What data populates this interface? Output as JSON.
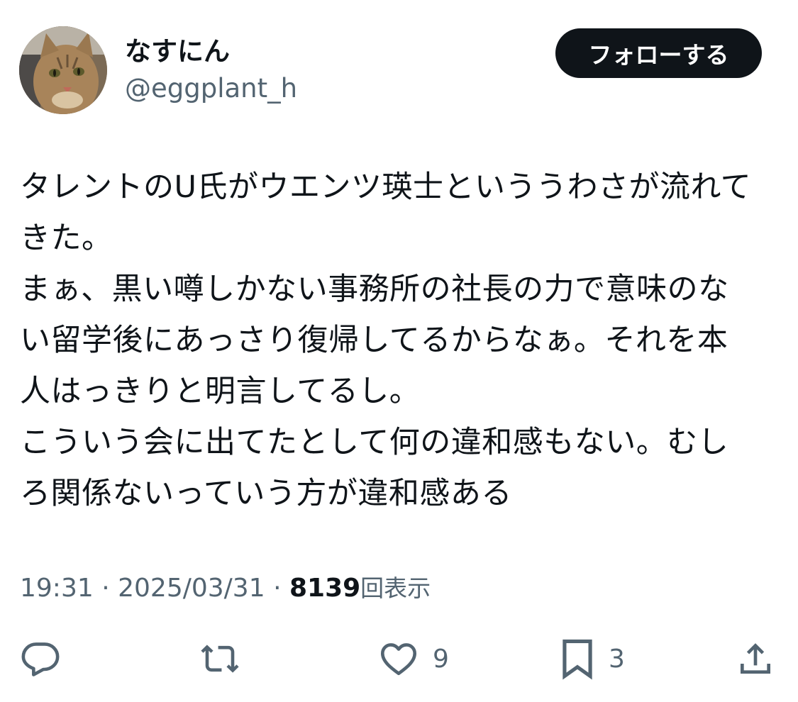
{
  "user": {
    "display_name": "なすにん",
    "handle": "@eggplant_h",
    "follow_label": "フォローする"
  },
  "tweet": {
    "lines": [
      "タレントのU氏がウエンツ瑛士といううわさが流れて",
      "きた。",
      "まぁ、黒い噂しかない事務所の社長の力で意味のな",
      "い留学後にあっさり復帰してるからなぁ。それを本",
      "人はっきりと明言してるし。",
      "こういう会に出てたとして何の違和感もない。むし",
      "ろ関係ないっていう方が違和感ある"
    ]
  },
  "meta": {
    "time": "19:31",
    "separator": "·",
    "date": "2025/03/31",
    "views_count": "8139",
    "views_label": "回表示"
  },
  "actions": {
    "reply_icon": "reply-icon",
    "retweet_icon": "retweet-icon",
    "like_icon": "heart-icon",
    "like_count": "9",
    "bookmark_icon": "bookmark-icon",
    "bookmark_count": "3",
    "share_icon": "share-icon"
  },
  "colors": {
    "text_primary": "#0f1419",
    "text_secondary": "#536471",
    "button_bg": "#0f1419",
    "button_text": "#ffffff"
  }
}
